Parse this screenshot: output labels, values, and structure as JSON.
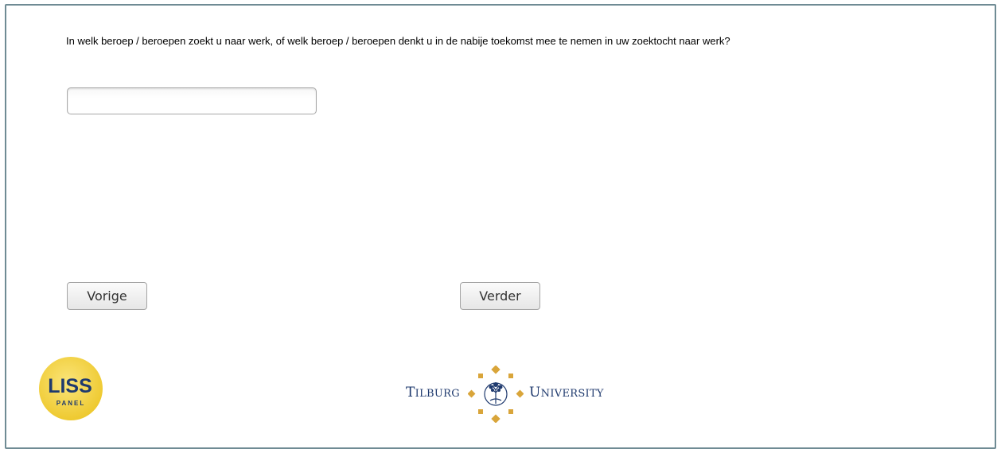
{
  "question": {
    "text": "In welk beroep / beroepen zoekt u naar werk, of welk beroep / beroepen denkt u in de nabije toekomst mee te nemen in uw zoektocht naar werk?"
  },
  "answer": {
    "value": "",
    "placeholder": ""
  },
  "navigation": {
    "prev_label": "Vorige",
    "next_label": "Verder"
  },
  "logos": {
    "liss": {
      "line1": "LISS",
      "line2": "PANEL",
      "colors": {
        "circle": "#f3d54a",
        "text": "#1f3a6e"
      }
    },
    "tilburg": {
      "left_initial": "T",
      "left_rest": "ilburg",
      "right_initial": "U",
      "right_rest": "niversity",
      "colors": {
        "text": "#1f3a6e",
        "diamonds": "#d9a53a"
      }
    }
  }
}
